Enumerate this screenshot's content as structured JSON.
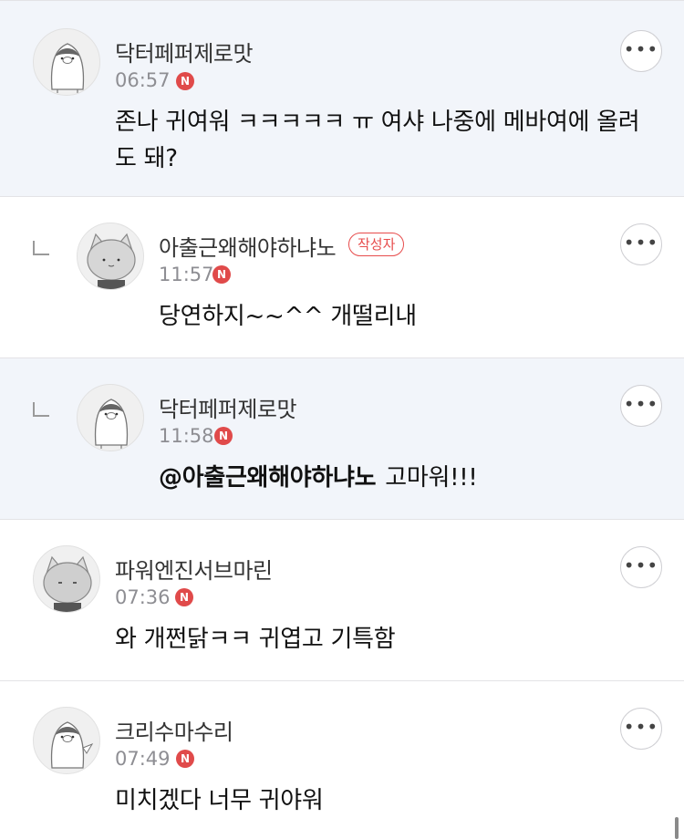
{
  "comments": [
    {
      "nickname": "닥터페퍼제로맛",
      "time": "06:57",
      "new_badge": "N",
      "text": "존나 귀여워 ㅋㅋㅋㅋㅋ ㅠ 여샤 나중에 메바여에 올려도 돼?",
      "more_label": "•••",
      "avatar_icon": "penguin-avatar-icon"
    },
    {
      "nickname": "아출근왜해야하냐노",
      "writer_badge": "작성자",
      "time": "11:57",
      "new_badge": "N",
      "text": "당연하지~~^^ 개떨리내",
      "more_label": "•••",
      "avatar_icon": "cat-avatar-icon"
    },
    {
      "nickname": "닥터페퍼제로맛",
      "time": "11:58",
      "new_badge": "N",
      "mention": "@아출근왜해야하냐노",
      "text": "고마워!!!",
      "more_label": "•••",
      "avatar_icon": "penguin-avatar-icon"
    },
    {
      "nickname": "파워엔진서브마린",
      "time": "07:36",
      "new_badge": "N",
      "text": "와 개쩐닭ㅋㅋ 귀엽고 기특함",
      "more_label": "•••",
      "avatar_icon": "cat-avatar-icon"
    },
    {
      "nickname": "크리수마수리",
      "time": "07:49",
      "new_badge": "N",
      "text": "미치겠다 너무 귀야워",
      "more_label": "•••",
      "avatar_icon": "penguin-avatar-icon"
    }
  ],
  "colors": {
    "highlight_bg": "#f2f5fa",
    "new_badge": "#e04a4a",
    "writer_badge": "#e74c4c"
  }
}
